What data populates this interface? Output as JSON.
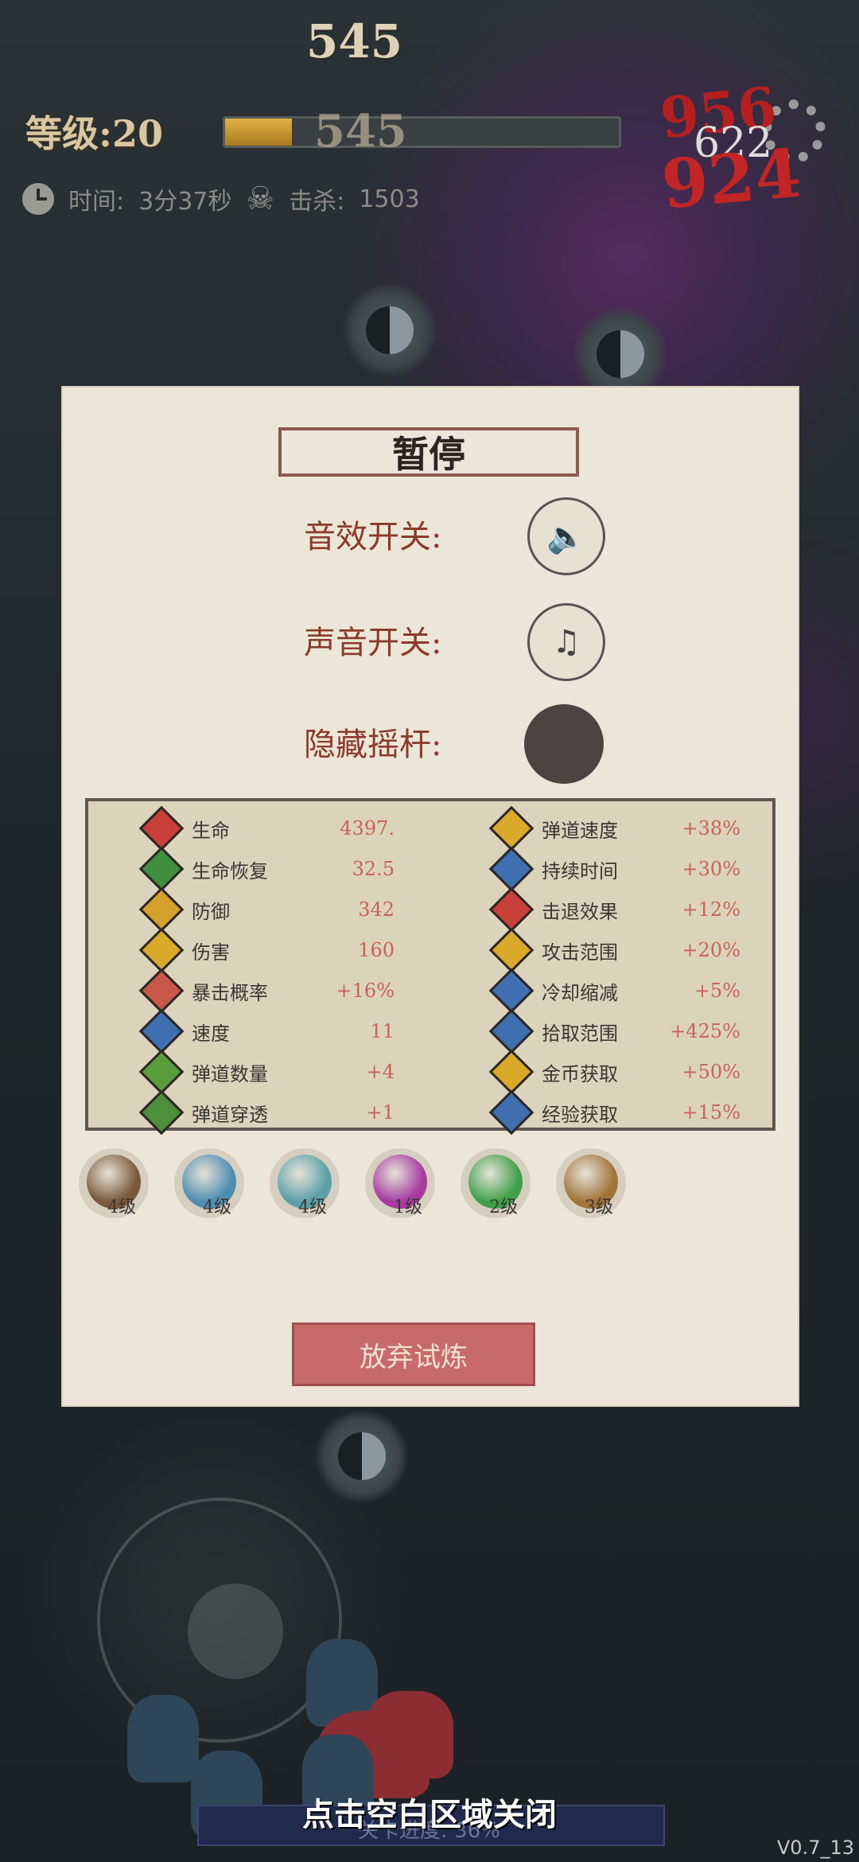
{
  "hud": {
    "top_counter": "545",
    "level_text": "等级:20",
    "xp_value": "545",
    "xp_progress": 0.17,
    "time_label": "时间:",
    "time_value": "3分37秒",
    "kill_label": "击杀:",
    "kill_value": "1503",
    "damage_numbers": [
      "956",
      "622",
      "924"
    ]
  },
  "pause": {
    "title": "暂停",
    "sound_effect_label": "音效开关:",
    "music_label": "声音开关:",
    "hide_joystick_label": "隐藏摇杆:",
    "quit_button": "放弃试炼"
  },
  "stats_left": [
    {
      "name": "生命",
      "value": "4397.",
      "color": "#c9403a"
    },
    {
      "name": "生命恢复",
      "value": "32.5",
      "color": "#3f8f3f"
    },
    {
      "name": "防御",
      "value": "342",
      "color": "#d4a22c"
    },
    {
      "name": "伤害",
      "value": "160",
      "color": "#d9a92a"
    },
    {
      "name": "暴击概率",
      "value": "+16%",
      "color": "#c9574a"
    },
    {
      "name": "速度",
      "value": "11",
      "color": "#3f6fb0"
    },
    {
      "name": "弹道数量",
      "value": "+4",
      "color": "#5b9c3d"
    },
    {
      "name": "弹道穿透",
      "value": "+1",
      "color": "#4f8e3b"
    }
  ],
  "stats_right": [
    {
      "name": "弹道速度",
      "value": "+38%",
      "color": "#d9a92a"
    },
    {
      "name": "持续时间",
      "value": "+30%",
      "color": "#3f6fb0"
    },
    {
      "name": "击退效果",
      "value": "+12%",
      "color": "#c9403a"
    },
    {
      "name": "攻击范围",
      "value": "+20%",
      "color": "#d9a92a"
    },
    {
      "name": "冷却缩减",
      "value": "+5%",
      "color": "#3f6fb0"
    },
    {
      "name": "拾取范围",
      "value": "+425%",
      "color": "#3f6fb0"
    },
    {
      "name": "金币获取",
      "value": "+50%",
      "color": "#d9a92a"
    },
    {
      "name": "经验获取",
      "value": "+15%",
      "color": "#3f6fb0"
    }
  ],
  "items": [
    {
      "icon": "flute-icon",
      "level": "4级",
      "color": "#7a5a3a"
    },
    {
      "icon": "yinyang-icon",
      "level": "4级",
      "color": "#4d8db0"
    },
    {
      "icon": "fan-icon",
      "level": "4级",
      "color": "#5aa0a8"
    },
    {
      "icon": "potion-icon",
      "level": "1级",
      "color": "#a63aa0"
    },
    {
      "icon": "jade-ring-icon",
      "level": "2级",
      "color": "#3fa04a"
    },
    {
      "icon": "gourd-icon",
      "level": "3级",
      "color": "#a0743a"
    }
  ],
  "footer": {
    "close_hint": "点击空白区域关闭",
    "progress_text": "关卡进度: 36%",
    "version": "V0.7_13"
  }
}
